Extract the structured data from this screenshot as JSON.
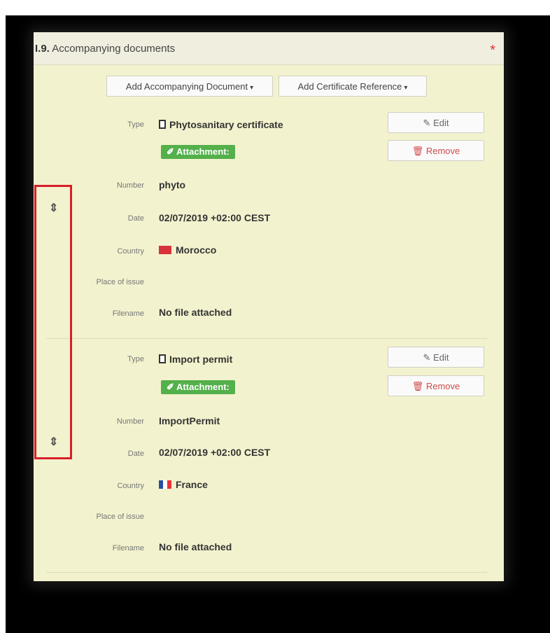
{
  "section": {
    "number": "I.9.",
    "title": "Accompanying documents",
    "required_mark": "*"
  },
  "toolbar": {
    "add_accompanying_document": "Add Accompanying Document",
    "add_certificate_reference": "Add Certificate Reference"
  },
  "labels": {
    "type": "Type",
    "number": "Number",
    "date": "Date",
    "country": "Country",
    "place_of_issue": "Place of issue",
    "filename": "Filename"
  },
  "actions": {
    "edit": "Edit",
    "remove": "Remove",
    "attachment": "Attachment:"
  },
  "drag_handle_glyph": "⇕",
  "documents": [
    {
      "type": "Phytosanitary certificate",
      "number": "phyto",
      "date": "02/07/2019 +02:00 CEST",
      "country": "Morocco",
      "place_of_issue": "",
      "filename": "No file attached"
    },
    {
      "type": "Import permit",
      "number": "ImportPermit",
      "date": "02/07/2019 +02:00 CEST",
      "country": "France",
      "place_of_issue": "",
      "filename": "No file attached"
    }
  ],
  "colors": {
    "panel_bg": "#f3f2ce",
    "attachment_green": "#53b04a",
    "remove_red": "#d04b4b",
    "highlight_red": "#d71f2a"
  },
  "icons": {
    "edit": "pencil-icon",
    "remove": "trash-icon",
    "attachment": "paperclip-icon",
    "document": "document-icon",
    "dropdown": "caret-down-icon",
    "required": "asterisk-icon",
    "drag": "drag-handle-icon"
  }
}
